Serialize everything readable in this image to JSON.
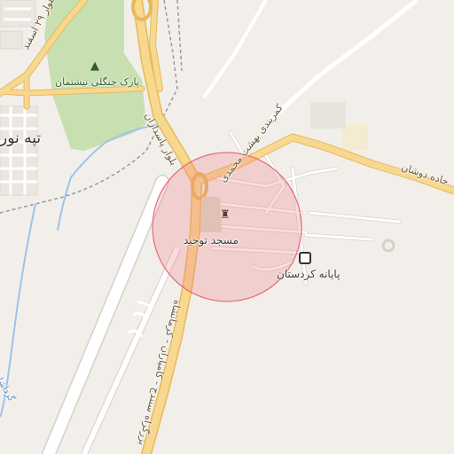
{
  "map": {
    "colors": {
      "background": "#f2efea",
      "park": "#c8dfb2",
      "major_road": "#f7d88f",
      "major_road_casing": "#e8b95b",
      "minor_road": "#ffffff",
      "minor_road_casing": "#d6d2cb",
      "runway": "#ffffff",
      "highlight_circle": "#f07d8a",
      "water": "#9cc3ea"
    },
    "labels": {
      "park": "پارک جنگلی نیشتمان",
      "boulevard_29_esfand": "بلوار ۲۹ اسفند",
      "boulevard_pasdaran": "بلوار پاسداران",
      "belt_beheshti": "کمربندی بهشت محمدی",
      "road_dowshan": "جاده دوشان",
      "mosque": "مسجد توحید",
      "terminal": "پایانه کردستان",
      "highway": "بزرگراه سنندج - کامیاران - کرمانشاه",
      "river": "گرداشان",
      "neighborhood": "تپه نور"
    },
    "icons": {
      "mosque": "mosque-icon",
      "bus": "bus-icon",
      "tree": "tree-icon"
    }
  }
}
